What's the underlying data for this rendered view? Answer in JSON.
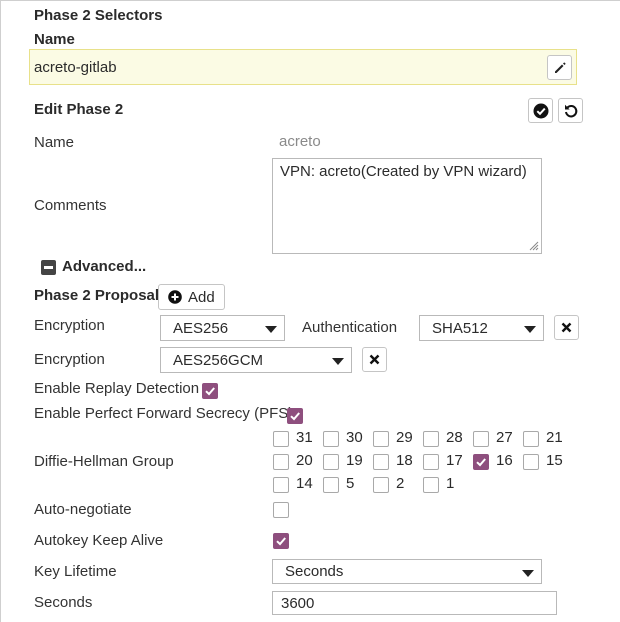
{
  "phase2_selectors": {
    "title": "Phase 2 Selectors",
    "name_label": "Name",
    "name_value": "acreto-gitlab"
  },
  "edit_phase2": {
    "title": "Edit Phase 2"
  },
  "form": {
    "name_label": "Name",
    "name_value": "acreto",
    "comments_label": "Comments",
    "comments_value": "VPN: acreto(Created by VPN wizard)",
    "advanced_label": "Advanced...",
    "proposal_label": "Phase 2 Proposal",
    "add_label": "Add",
    "encryption_label_1": "Encryption",
    "encryption_value_1": "AES256",
    "authentication_label": "Authentication",
    "authentication_value": "SHA512",
    "encryption_label_2": "Encryption",
    "encryption_value_2": "AES256GCM",
    "replay_label": "Enable Replay Detection",
    "replay_checked": true,
    "pfs_label": "Enable Perfect Forward Secrecy (PFS)",
    "pfs_checked": true,
    "dh_label": "Diffie-Hellman Group",
    "dh_groups": [
      {
        "label": "31",
        "checked": false
      },
      {
        "label": "30",
        "checked": false
      },
      {
        "label": "29",
        "checked": false
      },
      {
        "label": "28",
        "checked": false
      },
      {
        "label": "27",
        "checked": false
      },
      {
        "label": "21",
        "checked": false
      },
      {
        "label": "20",
        "checked": false
      },
      {
        "label": "19",
        "checked": false
      },
      {
        "label": "18",
        "checked": false
      },
      {
        "label": "17",
        "checked": false
      },
      {
        "label": "16",
        "checked": true
      },
      {
        "label": "15",
        "checked": false
      },
      {
        "label": "14",
        "checked": false
      },
      {
        "label": "5",
        "checked": false
      },
      {
        "label": "2",
        "checked": false
      },
      {
        "label": "1",
        "checked": false
      }
    ],
    "autoneg_label": "Auto-negotiate",
    "autoneg_checked": false,
    "keepalive_label": "Autokey Keep Alive",
    "keepalive_checked": true,
    "key_lifetime_label": "Key Lifetime",
    "key_lifetime_value": "Seconds",
    "seconds_label": "Seconds",
    "seconds_value": "3600"
  },
  "colors": {
    "accent": "#8e4f7e",
    "highlight_bg": "#fbfbe4",
    "highlight_border": "#e8e18a"
  },
  "icons": [
    "edit-icon",
    "checkmark-circle-icon",
    "undo-icon",
    "plus-circle-icon",
    "close-icon",
    "minus-box-icon",
    "resize-grip-icon"
  ]
}
